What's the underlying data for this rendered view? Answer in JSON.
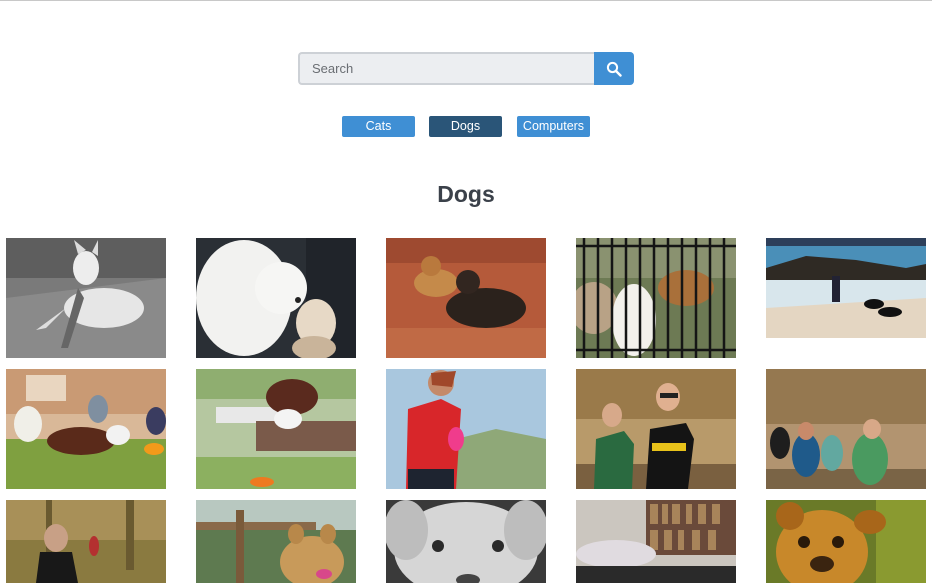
{
  "search": {
    "placeholder": "Search",
    "value": "",
    "button_icon": "search-icon"
  },
  "filters": [
    {
      "label": "Cats",
      "active": false
    },
    {
      "label": "Dogs",
      "active": true
    },
    {
      "label": "Computers",
      "active": false
    }
  ],
  "page": {
    "title": "Dogs"
  },
  "colors": {
    "accent": "#3f8fd4",
    "accent_active": "#2a5578",
    "title": "#3b414a"
  },
  "gallery": [
    {
      "subject": "white puppy lying in grass, black and white"
    },
    {
      "subject": "white poodle with small dog"
    },
    {
      "subject": "two dogs lying on red dirt"
    },
    {
      "subject": "dogs behind black fence"
    },
    {
      "subject": "person and dogs on rocky beach"
    },
    {
      "subject": "border collie catching frisbee"
    },
    {
      "subject": "dog leaping for frisbee"
    },
    {
      "subject": "woman in red shirt with frisbee"
    },
    {
      "subject": "runners in woods"
    },
    {
      "subject": "group running in forest"
    },
    {
      "subject": "woman with headphones running"
    },
    {
      "subject": "tan dog at wooden fence"
    },
    {
      "subject": "puppy face close-up, black and white"
    },
    {
      "subject": "dog lying on floor by bookshelves"
    },
    {
      "subject": "pug mix face close-up"
    }
  ]
}
